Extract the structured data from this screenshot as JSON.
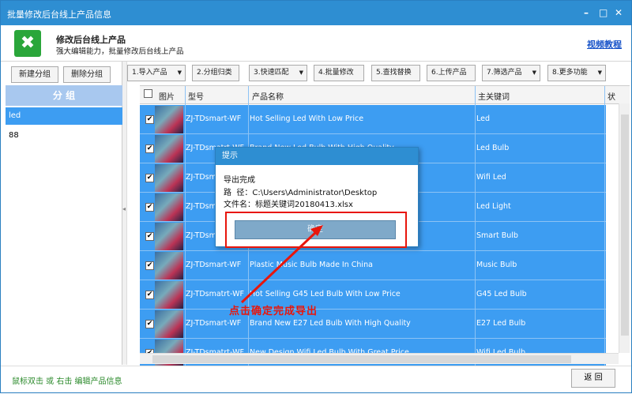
{
  "window": {
    "title": "批量修改后台线上产品信息"
  },
  "header": {
    "title": "修改后台线上产品",
    "subtitle": "强大编辑能力，批量修改后台线上产品",
    "tutorial_link": "视频教程"
  },
  "left": {
    "new_group": "新建分组",
    "delete_group": "删除分组",
    "group_header": "分 组",
    "groups": [
      "led",
      "88"
    ]
  },
  "toolbar": [
    "1.导入产品",
    "2.分组归类",
    "3.快速匹配",
    "4.批量修改",
    "5.查找替换",
    "6.上传产品",
    "7.筛选产品",
    "8.更多功能"
  ],
  "grid": {
    "columns": [
      "图片",
      "型号",
      "产品名称",
      "主关键词",
      "状"
    ],
    "rows": [
      {
        "model": "ZJ-TDsmart-WF",
        "name": "Hot Selling Led With Low Price",
        "keyword": "Led"
      },
      {
        "model": "ZJ-TDsmatrt-WF",
        "name": "Brand New Led Bulb With High Quality",
        "keyword": "Led Bulb"
      },
      {
        "model": "ZJ-TDsm",
        "name": "",
        "keyword": "Wifi Led"
      },
      {
        "model": "ZJ-TDsm",
        "name": "",
        "keyword": "Led Light"
      },
      {
        "model": "ZJ-TDsm",
        "name": "",
        "keyword": "Smart Bulb"
      },
      {
        "model": "ZJ-TDsmart-WF",
        "name": "Plastic Music Bulb Made In China",
        "keyword": "Music Bulb"
      },
      {
        "model": "ZJ-TDsmatrt-WF",
        "name": "Hot Selling G45 Led Bulb With Low Price",
        "keyword": "G45 Led Bulb"
      },
      {
        "model": "ZJ-TDsmart-WF",
        "name": "Brand New E27 Led Bulb With High Quality",
        "keyword": "E27 Led Bulb"
      },
      {
        "model": "ZJ-TDsmatrt-WF",
        "name": "New Design Wifi Led Bulb With Great Price",
        "keyword": "Wifi Led Bulb"
      }
    ]
  },
  "dialog": {
    "title": "提示",
    "line1": "导出完成",
    "line2": "路  径：C:\\Users\\Administrator\\Desktop",
    "line3": "文件名：标题关键词20180413.xlsx",
    "ok": "确定"
  },
  "annotation": "点击确定完成导出",
  "footer": {
    "tip": "鼠标双击 或 右击 编辑产品信息",
    "back": "返 回"
  },
  "colors": {
    "titlebar": "#2e8ed2",
    "selection": "#3d9df2",
    "annotation": "#e8160c"
  }
}
